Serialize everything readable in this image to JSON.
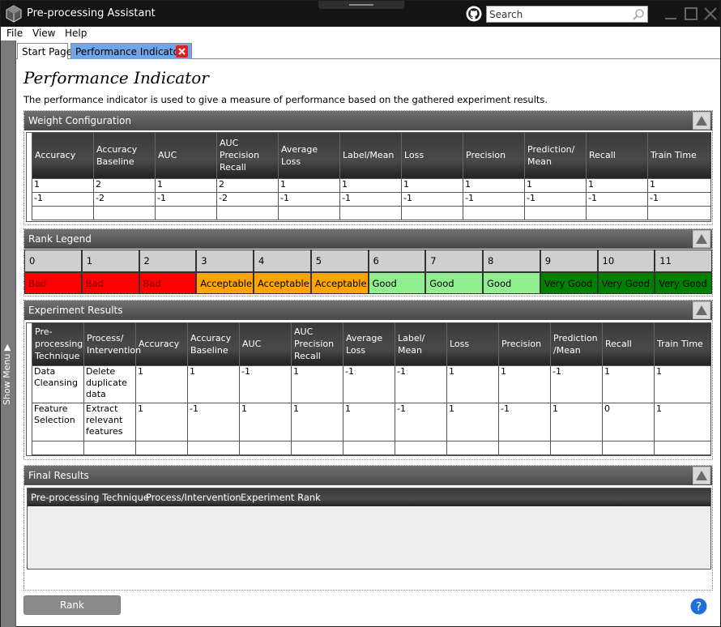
{
  "app": {
    "title": "Pre-processing Assistant"
  },
  "search": {
    "placeholder": "Search",
    "value": ""
  },
  "menu": [
    {
      "label": "File"
    },
    {
      "label": "View"
    },
    {
      "label": "Help"
    }
  ],
  "side_menu": {
    "label": "Show Menu ▶"
  },
  "tabs": [
    {
      "label": "Start Page"
    },
    {
      "label": "Performance Indicator"
    }
  ],
  "page": {
    "title": "Performance Indicator",
    "description": "The performance indicator is used to give a measure of performance based on the gathered experiment results."
  },
  "weight_config": {
    "title": "Weight Configuration",
    "headers": [
      "Accuracy",
      "Accuracy Baseline",
      "AUC",
      "AUC Precision Recall",
      "Average Loss",
      "Label/Mean",
      "Loss",
      "Precision",
      "Prediction/ Mean",
      "Recall",
      "Train Time"
    ],
    "rows": [
      [
        "1",
        "2",
        "1",
        "2",
        "1",
        "1",
        "1",
        "1",
        "1",
        "1",
        "1"
      ],
      [
        "-1",
        "-2",
        "-1",
        "-2",
        "-1",
        "-1",
        "-1",
        "-1",
        "-1",
        "-1",
        "-1"
      ],
      [
        "",
        "",
        "",
        "",
        "",
        "",
        "",
        "",
        "",
        "",
        ""
      ]
    ]
  },
  "rank_legend": {
    "title": "Rank Legend",
    "items": [
      {
        "number": "0",
        "label": "Bad",
        "color": "#ff0000",
        "text_color": "#7a0000"
      },
      {
        "number": "1",
        "label": "Bad",
        "color": "#ff0000",
        "text_color": "#7a0000"
      },
      {
        "number": "2",
        "label": "Bad",
        "color": "#ff0000",
        "text_color": "#7a0000"
      },
      {
        "number": "3",
        "label": "Acceptable",
        "color": "#ffa500",
        "text_color": "#000000"
      },
      {
        "number": "4",
        "label": "Acceptable",
        "color": "#ffa500",
        "text_color": "#000000"
      },
      {
        "number": "5",
        "label": "Acceptable",
        "color": "#ffa500",
        "text_color": "#000000"
      },
      {
        "number": "6",
        "label": "Good",
        "color": "#90ee90",
        "text_color": "#000000"
      },
      {
        "number": "7",
        "label": "Good",
        "color": "#90ee90",
        "text_color": "#000000"
      },
      {
        "number": "8",
        "label": "Good",
        "color": "#90ee90",
        "text_color": "#000000"
      },
      {
        "number": "9",
        "label": "Very Good",
        "color": "#008000",
        "text_color": "#000000"
      },
      {
        "number": "10",
        "label": "Very Good",
        "color": "#008000",
        "text_color": "#000000"
      },
      {
        "number": "11",
        "label": "Very Good",
        "color": "#008000",
        "text_color": "#000000"
      }
    ]
  },
  "experiment_results": {
    "title": "Experiment Results",
    "headers": [
      "Pre-processing Technique",
      "Process/ Intervention",
      "Accuracy",
      "Accuracy Baseline",
      "AUC",
      "AUC Precision Recall",
      "Average Loss",
      "Label/ Mean",
      "Loss",
      "Precision",
      "Prediction /Mean",
      "Recall",
      "Train Time"
    ],
    "rows": [
      [
        "Data Cleansing",
        "Delete duplicate data",
        "1",
        "1",
        "-1",
        "1",
        "-1",
        "-1",
        "1",
        "1",
        "-1",
        "1",
        "1"
      ],
      [
        "Feature Selection",
        "Extract relevant features",
        "1",
        "-1",
        "1",
        "1",
        "1",
        "-1",
        "1",
        "-1",
        "1",
        "0",
        "1"
      ],
      [
        "",
        "",
        "",
        "",
        "",
        "",
        "",
        "",
        "",
        "",
        "",
        "",
        ""
      ]
    ]
  },
  "final_results": {
    "title": "Final Results",
    "headers": [
      "Pre-processing Technique",
      "Process/Intervention",
      "Experiment Rank"
    ]
  },
  "rank_button": {
    "label": "Rank"
  }
}
